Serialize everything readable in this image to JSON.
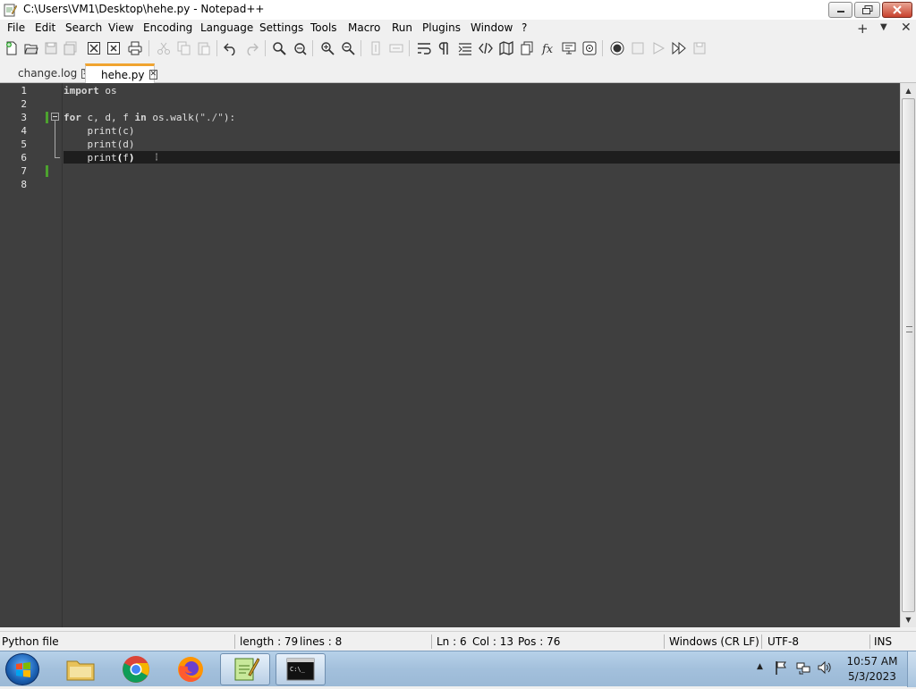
{
  "window": {
    "title": "C:\\Users\\VM1\\Desktop\\hehe.py - Notepad++"
  },
  "menu": {
    "items": [
      "File",
      "Edit",
      "Search",
      "View",
      "Encoding",
      "Language",
      "Settings",
      "Tools",
      "Macro",
      "Run",
      "Plugins",
      "Window",
      "?"
    ],
    "extras": {
      "plus": "+",
      "dropdown": "▼",
      "close": "✕"
    }
  },
  "toolbar": {
    "icons": [
      "new-file-icon",
      "open-file-icon",
      "save-icon",
      "save-all-icon",
      "close-icon",
      "close-all-icon",
      "print-icon",
      "cut-icon",
      "copy-icon",
      "paste-icon",
      "undo-icon",
      "redo-icon",
      "find-icon",
      "replace-icon",
      "zoom-in-icon",
      "zoom-out-icon",
      "sync-vertical-icon",
      "sync-horizontal-icon",
      "word-wrap-icon",
      "show-all-chars-icon",
      "indent-guide-icon",
      "xml-tags-icon",
      "document-map-icon",
      "clone-icon",
      "function-list-icon",
      "folder-workspace-icon",
      "monitoring-icon",
      "record-macro-icon",
      "stop-macro-icon",
      "play-macro-icon",
      "run-macro-multiple-icon",
      "save-macro-icon"
    ]
  },
  "tabs": [
    {
      "label": "change.log",
      "active": false
    },
    {
      "label": "hehe.py",
      "active": true
    }
  ],
  "editor": {
    "line_numbers": [
      "1",
      "2",
      "3",
      "4",
      "5",
      "6",
      "7",
      "8"
    ],
    "lines": [
      {
        "kw": "import",
        "rest": " os"
      },
      {
        "text": ""
      },
      {
        "kw": "for",
        "mid1": " c, d, f ",
        "kw2": "in",
        "mid2": " os.walk(",
        "str": "\"./\"",
        "end": "):"
      },
      {
        "text": "    print(c)"
      },
      {
        "text": "    print(d)"
      },
      {
        "pre": "    print",
        "paren_open": "(",
        "arg": "f",
        "paren_close": ")"
      },
      {
        "text": ""
      },
      {
        "text": ""
      }
    ],
    "current_line": 6
  },
  "statusbar": {
    "file_type": "Python file",
    "length": "length : 79",
    "lines": "lines : 8",
    "ln": "Ln : 6",
    "col": "Col : 13",
    "pos": "Pos : 76",
    "eol": "Windows (CR LF)",
    "encoding": "UTF-8",
    "mode": "INS"
  },
  "taskbar": {
    "clock_time": "10:57 AM",
    "clock_date": "5/3/2023"
  },
  "colors": {
    "tab_accent": "#f0a430",
    "editor_bg": "#3f3f3f",
    "change_marker": "#4ca22e"
  }
}
